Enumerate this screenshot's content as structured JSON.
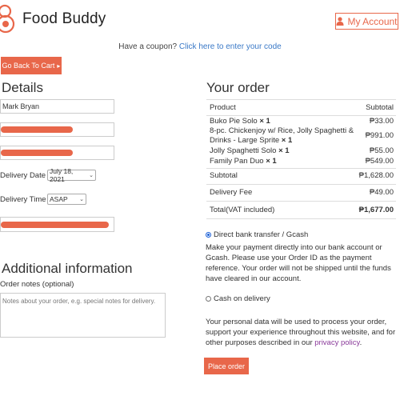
{
  "header": {
    "brand": "Food Buddy",
    "account_label": "My Account"
  },
  "coupon": {
    "prompt": "Have a coupon?",
    "link": "Click here to enter your code"
  },
  "back_button": "Go Back To Cart",
  "details": {
    "title": "Details",
    "name_value": "Mark Bryan",
    "delivery_date_label": "Delivery Date",
    "delivery_date_value": "July 18, 2021",
    "delivery_time_label": "Delivery Time",
    "delivery_time_value": "ASAP"
  },
  "additional": {
    "title": "Additional information",
    "notes_label": "Order notes (optional)",
    "notes_placeholder": "Notes about your order, e.g. special notes for delivery."
  },
  "order": {
    "title": "Your order",
    "col_product": "Product",
    "col_subtotal": "Subtotal",
    "items": [
      {
        "name": "Buko Pie Solo",
        "qty": "× 1",
        "price": "₱33.00"
      },
      {
        "name": "8-pc. Chickenjoy w/ Rice, Jolly Spaghetti & Drinks - Large Sprite",
        "qty": "× 1",
        "price": "₱991.00"
      },
      {
        "name": "Jolly Spaghetti Solo",
        "qty": "× 1",
        "price": "₱55.00"
      },
      {
        "name": "Family Pan Duo",
        "qty": "× 1",
        "price": "₱549.00"
      }
    ],
    "subtotal_label": "Subtotal",
    "subtotal_value": "₱1,628.00",
    "fee_label": "Delivery Fee",
    "fee_value": "₱49.00",
    "total_label": "Total(VAT included)",
    "total_value": "₱1,677.00"
  },
  "payment": {
    "option1": "Direct bank transfer / Gcash",
    "option1_desc": "Make your payment directly into our bank account or Gcash. Please use your Order ID as the payment reference. Your order will not be shipped until the funds have cleared in our account.",
    "option2": "Cash on delivery",
    "privacy_text": "Your personal data will be used to process your order, support your experience throughout this website, and for other purposes described in our",
    "privacy_link": "privacy policy",
    "place_order": "Place order"
  },
  "colors": {
    "accent": "#e8674a",
    "link": "#3a79c7",
    "privacy_link": "#8a3a9a",
    "radio_checked": "#1a5fd6"
  }
}
